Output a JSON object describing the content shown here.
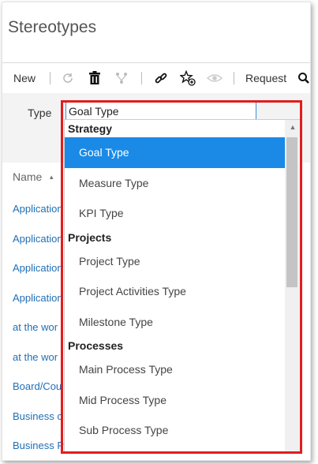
{
  "title": "Stereotypes",
  "toolbar": {
    "new_label": "New",
    "request_label": "Request",
    "icons": [
      "refresh-icon",
      "trash-icon",
      "hierarchy-icon",
      "link-icon",
      "star-add-icon",
      "eye-icon",
      "search-icon"
    ]
  },
  "filter": {
    "type_label": "Type",
    "type_value": "Goal Type"
  },
  "list": {
    "header": "Name",
    "rows": [
      "Application",
      "Application",
      "Application",
      "Application",
      "at the wor",
      "at the wor",
      "Board/Cou",
      "Business c",
      "Business P"
    ]
  },
  "dropdown": {
    "groups": [
      {
        "name": "Strategy",
        "options": [
          "Goal Type",
          "Measure Type",
          "KPI Type"
        ]
      },
      {
        "name": "Projects",
        "options": [
          "Project Type",
          "Project Activities Type",
          "Milestone Type"
        ]
      },
      {
        "name": "Processes",
        "options": [
          "Main Process Type",
          "Mid Process Type",
          "Sub Process Type"
        ]
      }
    ],
    "selected": "Goal Type"
  },
  "colors": {
    "accent": "#1a8ae6",
    "link": "#1f6fb5",
    "highlight_border": "#e11d1d"
  }
}
